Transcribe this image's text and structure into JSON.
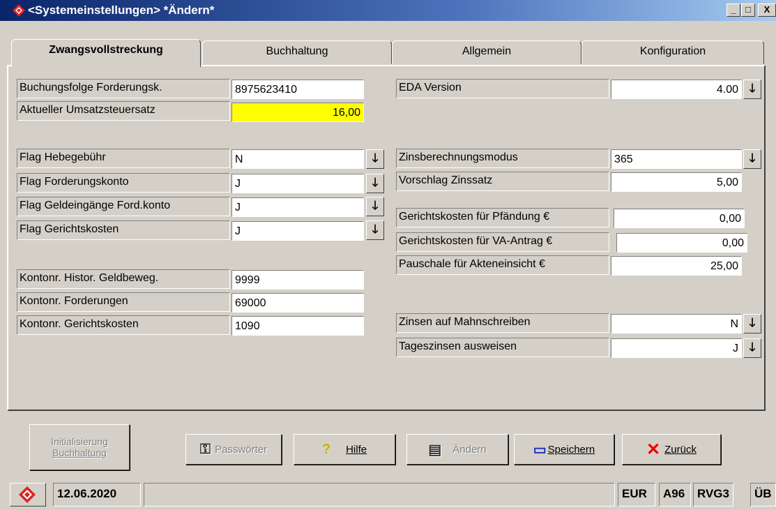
{
  "window": {
    "title": "<Systemeinstellungen>  *Ändern*",
    "minimize": "_",
    "maximize": "□",
    "close": "X"
  },
  "tabs": [
    "Zwangsvollstreckung",
    "Buchhaltung",
    "Allgemein",
    "Konfiguration"
  ],
  "left": {
    "buchungsfolge_label": "Buchungsfolge Forderungsk.",
    "buchungsfolge_value": "8975623410",
    "umsatzsteuer_label": "Aktueller Umsatzsteuersatz",
    "umsatzsteuer_value": "16,00",
    "flag_hebe_label": "Flag Hebegebühr",
    "flag_hebe_value": "N",
    "flag_ford_label": "Flag Forderungskonto",
    "flag_ford_value": "J",
    "flag_geld_label": "Flag Geldeingänge Ford.konto",
    "flag_geld_value": "J",
    "flag_gericht_label": "Flag Gerichtskosten",
    "flag_gericht_value": "J",
    "konto_histor_label": "Kontonr. Histor. Geldbeweg.",
    "konto_histor_value": "9999",
    "konto_ford_label": "Kontonr. Forderungen",
    "konto_ford_value": "69000",
    "konto_gericht_label": "Kontonr. Gerichtskosten",
    "konto_gericht_value": "1090"
  },
  "right": {
    "eda_label": "EDA Version",
    "eda_value": "4.00",
    "zinsmodus_label": "Zinsberechnungsmodus",
    "zinsmodus_value": "365",
    "zinssatz_label": "Vorschlag Zinssatz",
    "zinssatz_value": "5,00",
    "gk_pfaendung_label": "Gerichtskosten für Pfändung €",
    "gk_pfaendung_value": "0,00",
    "gk_va_label": "Gerichtskosten für VA-Antrag €",
    "gk_va_value": "0,00",
    "pauschale_label": "Pauschale für Akteneinsicht  €",
    "pauschale_value": "25,00",
    "zinsen_mahn_label": "Zinsen auf Mahnschreiben",
    "zinsen_mahn_value": "N",
    "tageszinsen_label": "Tageszinsen ausweisen",
    "tageszinsen_value": "J"
  },
  "dropdown_glyph": "🡓",
  "buttons": {
    "init_line1": "Initialisierung",
    "init_line2": "Buchhaltung",
    "passwoerter": "Passwörter",
    "hilfe": "Hilfe",
    "aendern": "Ändern",
    "speichern": "Speichern",
    "zurueck": "Zurück"
  },
  "status": {
    "date": "12.06.2020",
    "currency": "EUR",
    "code1": "A96",
    "code2": "RVG3",
    "code3": "ÜB"
  }
}
